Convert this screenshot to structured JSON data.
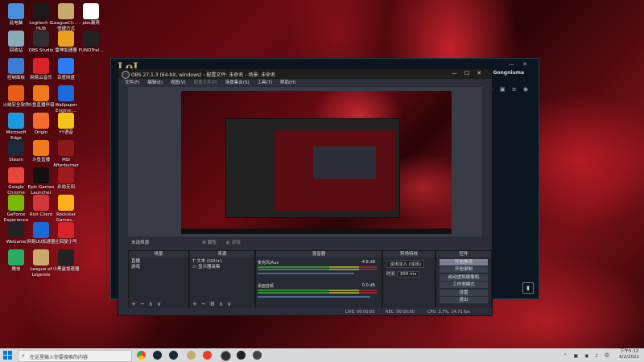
{
  "desktop": {
    "icons": [
      {
        "label": "此电脑",
        "color": "#4a90d9"
      },
      {
        "label": "Logitech G HUB",
        "color": "#1a1a1a"
      },
      {
        "label": "LeagueCli... - 快捷方式",
        "color": "#c8aa6e"
      },
      {
        "label": "pbe漏洞",
        "color": "#ffffff"
      },
      {
        "label": "回收站",
        "color": "#8ab"
      },
      {
        "label": "OBS Studio",
        "color": "#302e31"
      },
      {
        "label": "雷神加速器",
        "color": "#e8a020"
      },
      {
        "label": "FUNOTrai...",
        "color": "#222"
      },
      {
        "label": "控制面板",
        "color": "#3a7bd5"
      },
      {
        "label": "网易云音乐",
        "color": "#d8232a"
      },
      {
        "label": "百度网盘",
        "color": "#2b7bf3"
      },
      {
        "label": "火绒安全软件",
        "color": "#e85d1a"
      },
      {
        "label": "斗鱼直播伴侣",
        "color": "#f07a1a"
      },
      {
        "label": "Wallpaper Engine:...",
        "color": "#1e6ad8"
      },
      {
        "label": "Microsoft Edge",
        "color": "#1a9ae0"
      },
      {
        "label": "Origin",
        "color": "#f56c2d"
      },
      {
        "label": "YY语音",
        "color": "#f5c21a"
      },
      {
        "label": "Steam",
        "color": "#1b2838"
      },
      {
        "label": "斗鱼直播",
        "color": "#f07a1a"
      },
      {
        "label": "MSI Afterburner",
        "color": "#8a1a1a"
      },
      {
        "label": "Google Chrome",
        "color": "#e8453c"
      },
      {
        "label": "Epic Games Launcher",
        "color": "#111"
      },
      {
        "label": "永劫无间",
        "color": "#a01a1a"
      },
      {
        "label": "GeForce Experience",
        "color": "#76b900"
      },
      {
        "label": "Riot Client",
        "color": "#d13639"
      },
      {
        "label": "Rockstar Games...",
        "color": "#fcaf17"
      },
      {
        "label": "WeGame",
        "color": "#222"
      },
      {
        "label": "网易UU加速器",
        "color": "#1a6ad8"
      },
      {
        "label": "主回复小号",
        "color": "#d8232a"
      },
      {
        "label": "微信",
        "color": "#2aae67"
      },
      {
        "label": "League of Legends",
        "color": "#c8aa6e"
      },
      {
        "label": "小黑盒加速器",
        "color": "#222"
      }
    ]
  },
  "lol_client": {
    "title": "LoL",
    "username": "Gongniuma",
    "icons": [
      "social-icon",
      "friend-add-icon",
      "folder-icon",
      "list-icon",
      "chat-icon"
    ]
  },
  "obs": {
    "title": "OBS 27.1.3 (64-bit, windows) - 配置文件: 未命名 - 场景: 未命名",
    "menu": [
      "文件(F)",
      "编辑(E)",
      "视图(V)",
      "配置文件(P)",
      "场景集合(S)",
      "工具(T)",
      "帮助(H)"
    ],
    "no_source": "未选择源",
    "props": "属性",
    "filters": "滤镜",
    "docks": {
      "scenes": {
        "title": "场景",
        "items": [
          "直播",
          "游戏"
        ]
      },
      "sources": {
        "title": "来源",
        "items": [
          "文本 (GDI+)",
          "显示器采集"
        ]
      },
      "mixer": {
        "title": "混音器",
        "channels": [
          {
            "name": "麦克风/Aux",
            "db": "-4.8 dB"
          },
          {
            "name": "桌面音频",
            "db": "0.0 dB"
          }
        ]
      },
      "transitions": {
        "title": "转场特效",
        "type": "淡出淡入 (淡出)",
        "duration_label": "时长",
        "duration": "300 ms"
      },
      "controls": {
        "title": "控件",
        "buttons": [
          "开始推流",
          "开始录制",
          "启动虚拟摄像机",
          "工作室模式",
          "设置",
          "退出"
        ]
      }
    },
    "status": {
      "live": "LIVE: 00:00:00",
      "rec": "REC: 00:00:00",
      "cpu": "CPU: 3.7%, 14.71 fps"
    }
  },
  "taskbar": {
    "search_placeholder": "在这里输入你要搜索的内容",
    "apps": [
      "chrome-icon",
      "steam-icon",
      "steam-icon",
      "lol-icon",
      "lol-client-icon",
      "obs-icon",
      "media-icon"
    ],
    "time": "下午5:12",
    "date": "6/2/2022"
  }
}
